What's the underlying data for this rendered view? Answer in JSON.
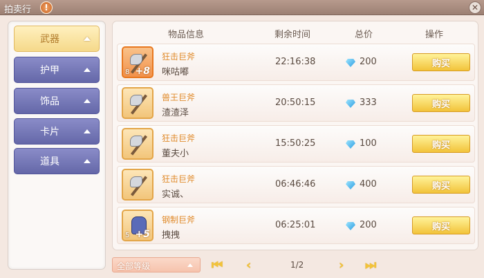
{
  "window": {
    "title": "拍卖行"
  },
  "sidebar": {
    "categories": [
      {
        "label": "武器",
        "active": true
      },
      {
        "label": "护甲",
        "active": false
      },
      {
        "label": "饰品",
        "active": false
      },
      {
        "label": "卡片",
        "active": false
      },
      {
        "label": "道具",
        "active": false
      }
    ]
  },
  "table": {
    "headers": {
      "item": "物品信息",
      "time": "剩余时间",
      "price": "总价",
      "action": "操作"
    },
    "rows": [
      {
        "icon": "axe-icon",
        "refine": "8",
        "plus": "+8",
        "name": "狂击巨斧",
        "seller": "咪咕嘟",
        "time": "22:16:38",
        "price": "200",
        "buy": "购买"
      },
      {
        "icon": "axe-icon",
        "refine": "",
        "plus": "",
        "name": "兽王巨斧",
        "seller": "渣渣泽",
        "time": "20:50:15",
        "price": "333",
        "buy": "购买"
      },
      {
        "icon": "axe-icon",
        "refine": "",
        "plus": "",
        "name": "狂击巨斧",
        "seller": "董夫小",
        "time": "15:50:25",
        "price": "100",
        "buy": "购买"
      },
      {
        "icon": "axe-icon",
        "refine": "",
        "plus": "",
        "name": "狂击巨斧",
        "seller": "实诚、",
        "time": "06:46:46",
        "price": "400",
        "buy": "购买"
      },
      {
        "icon": "armor-icon",
        "refine": "5",
        "plus": "+5",
        "name": "钢制巨斧",
        "seller": "拽拽",
        "time": "06:25:01",
        "price": "200",
        "buy": "购买"
      }
    ]
  },
  "footer": {
    "level_filter": "全部等级",
    "page": "1/2"
  },
  "colors": {
    "accent": "#f2c33a",
    "tab": "#6467a8",
    "item_name": "#e08a2a"
  }
}
